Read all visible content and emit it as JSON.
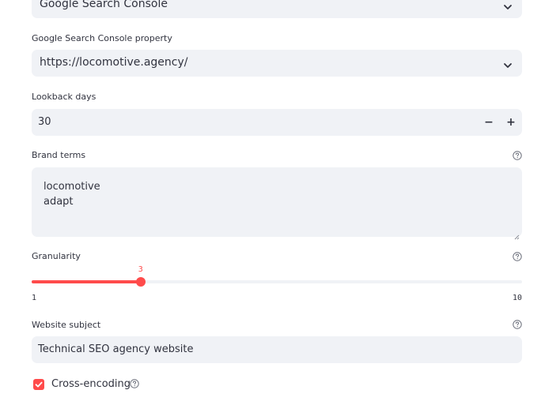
{
  "source_select": {
    "value": "Google Search Console"
  },
  "property": {
    "label": "Google Search Console property",
    "value": "https://locomotive.agency/"
  },
  "lookback": {
    "label": "Lookback days",
    "value": "30",
    "minus": "−",
    "plus": "+"
  },
  "brand_terms": {
    "label": "Brand terms",
    "value": "locomotive\nadapt"
  },
  "granularity": {
    "label": "Granularity",
    "min": 1,
    "max": 10,
    "value": 3,
    "min_label": "1",
    "max_label": "10",
    "value_label": "3"
  },
  "website_subject": {
    "label": "Website subject",
    "value": "Technical SEO agency website"
  },
  "cross_encoding": {
    "label": "Cross-encoding",
    "checked": true
  },
  "colors": {
    "accent": "#ff4b4b",
    "field_bg": "#f0f2f6",
    "text": "#31333f"
  },
  "icons": {
    "help": "help-circle-icon",
    "dropdown": "chevron-down-icon",
    "check": "check-icon"
  }
}
